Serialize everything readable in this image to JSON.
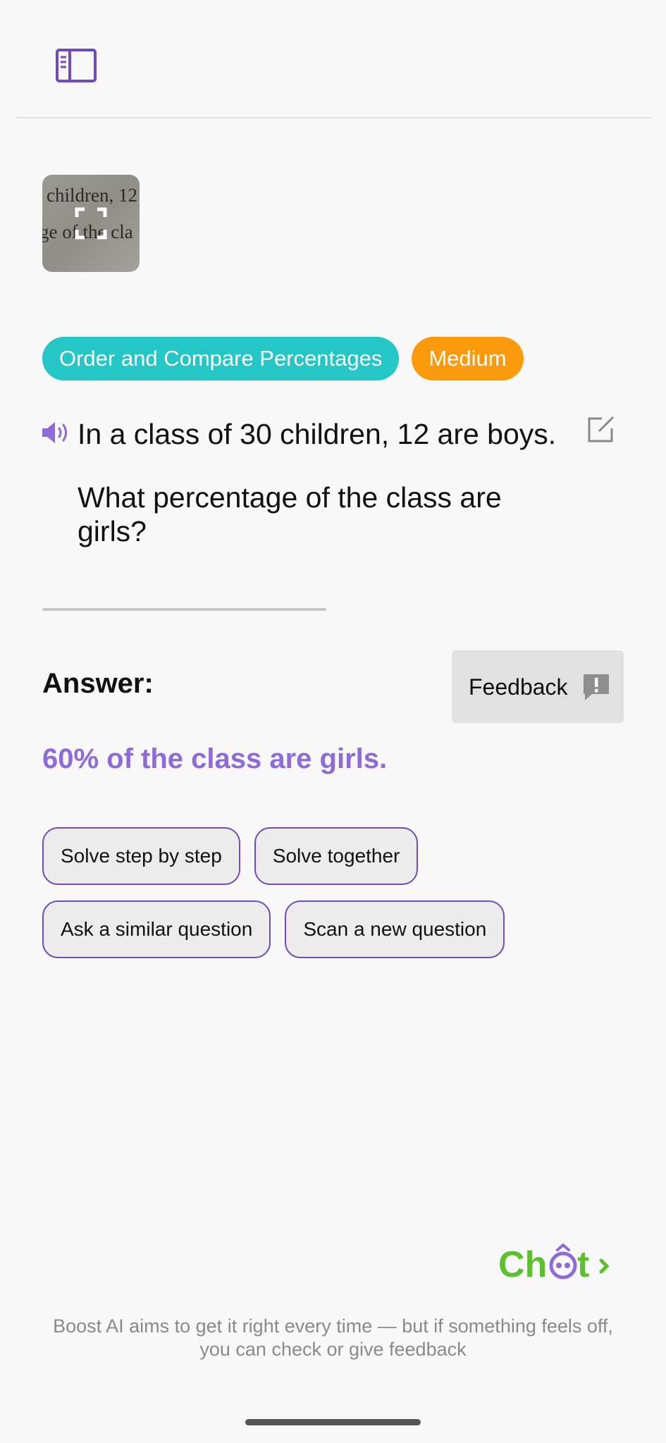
{
  "header": {
    "menu_icon": "sidebar-panel-icon"
  },
  "scan": {
    "thumbnail_text_line1": "children, 12",
    "thumbnail_text_line2": "ge of the cla",
    "expand_icon": "fullscreen-icon"
  },
  "tags": {
    "topic": "Order and Compare Percentages",
    "difficulty": "Medium"
  },
  "question": {
    "line1": "In a class of 30 children, 12 are boys.",
    "line2": "What percentage of the class are girls?",
    "speaker_icon": "speaker-icon",
    "edit_icon": "edit-icon"
  },
  "answer": {
    "label": "Answer:",
    "text": "60% of the class are girls."
  },
  "feedback": {
    "label": "Feedback",
    "icon": "feedback-exclamation-icon"
  },
  "actions": [
    "Solve step by step",
    "Solve together",
    "Ask a similar question",
    "Scan a new question"
  ],
  "branding": {
    "logo_text": "Chat"
  },
  "disclaimer": "Boost AI aims to get it right every time — but if something feels off, you can check or give feedback",
  "colors": {
    "accent_purple": "#6e4cbe",
    "answer_purple": "#8e6bd9",
    "topic_teal": "#25c6c6",
    "difficulty_orange": "#fb9a0d",
    "logo_green": "#5cc02f"
  }
}
